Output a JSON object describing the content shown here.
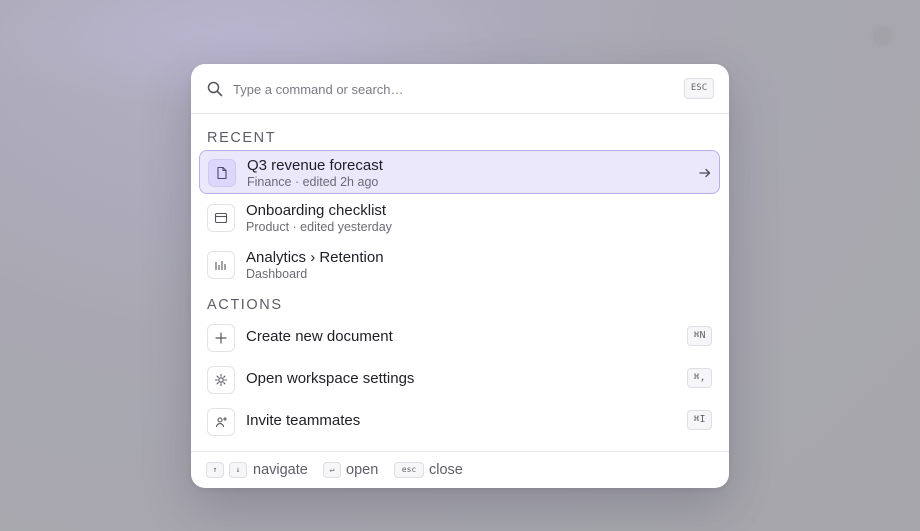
{
  "search": {
    "placeholder": "Type a command or search…",
    "esc_key": "ESC"
  },
  "sections": {
    "recent": "RECENT",
    "actions": "ACTIONS"
  },
  "recent": [
    {
      "title": "Q3 revenue forecast",
      "subtitle": "Finance · edited 2h ago",
      "icon": "document-icon",
      "selected": true
    },
    {
      "title": "Onboarding checklist",
      "subtitle": "Product · edited yesterday",
      "icon": "browser-window-icon",
      "selected": false
    },
    {
      "title": "Analytics › Retention",
      "subtitle": "Dashboard",
      "icon": "bar-chart-icon",
      "selected": false
    }
  ],
  "actions": [
    {
      "label": "Create new document",
      "shortcut": "⌘N",
      "icon": "plus-icon"
    },
    {
      "label": "Open workspace settings",
      "shortcut": "⌘,",
      "icon": "gear-icon"
    },
    {
      "label": "Invite teammates",
      "shortcut": "⌘I",
      "icon": "user-plus-icon"
    }
  ],
  "footer": {
    "up_key": "↑",
    "down_key": "↓",
    "navigate": "navigate",
    "enter_key": "↵",
    "open": "open",
    "esc_key": "esc",
    "close": "close"
  },
  "colors": {
    "accent": "#b7b0ec",
    "selected_bg": "#ebe8fb",
    "backdrop": "#a9a8b2"
  }
}
